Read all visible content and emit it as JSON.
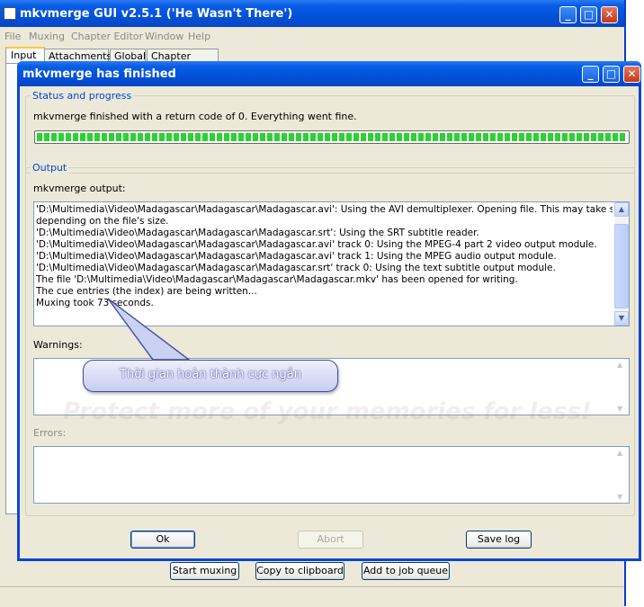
{
  "main_window": {
    "title": "mkvmerge GUI v2.5.1 ('He Wasn't There')",
    "menu": [
      "File",
      "Muxing",
      "Chapter Editor",
      "Window",
      "Help"
    ],
    "tabs": [
      "Input",
      "Attachments",
      "Global",
      "Chapter Editor"
    ],
    "buttons": {
      "start_muxing": "Start muxing",
      "copy_clipboard": "Copy to clipboard",
      "add_job_queue": "Add to job queue"
    }
  },
  "dialog": {
    "title": "mkvmerge has finished",
    "status_group_label": "Status and progress",
    "status_text": "mkvmerge finished with a return code of 0. Everything went fine.",
    "progress": 1.0,
    "output_group_label": "Output",
    "output_label": "mkvmerge output:",
    "output_lines": [
      "'D:\\Multimedia\\Video\\Madagascar\\Madagascar\\Madagascar.avi': Using the AVI demultiplexer. Opening file. This may take some time",
      "depending on the file's size.",
      "'D:\\Multimedia\\Video\\Madagascar\\Madagascar\\Madagascar.srt': Using the SRT subtitle reader.",
      "'D:\\Multimedia\\Video\\Madagascar\\Madagascar\\Madagascar.avi' track 0: Using the MPEG-4 part 2 video output module.",
      "'D:\\Multimedia\\Video\\Madagascar\\Madagascar\\Madagascar.avi' track 1: Using the MPEG audio output module.",
      "'D:\\Multimedia\\Video\\Madagascar\\Madagascar\\Madagascar.srt' track 0: Using the text subtitle output module.",
      "The file 'D:\\Multimedia\\Video\\Madagascar\\Madagascar\\Madagascar.mkv' has been opened for writing.",
      "The cue entries (the index) are being written...",
      "Muxing took 73 seconds."
    ],
    "warnings_label": "Warnings:",
    "errors_label": "Errors:",
    "buttons": {
      "ok": "Ok",
      "abort": "Abort",
      "save_log": "Save log"
    }
  },
  "callout": {
    "text": "Thời gian hoàn thành cực ngắn"
  },
  "watermark": "Protect more of your memories for less!",
  "colors": {
    "accent": "#0a5ee6",
    "progress": "#2bd230",
    "dialog_bg": "#ece9d8"
  }
}
